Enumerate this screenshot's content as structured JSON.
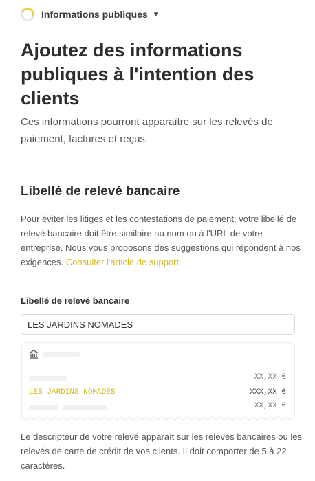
{
  "header": {
    "section_selector": "Informations publiques",
    "icons": {
      "progress": "progress-ring-icon",
      "dropdown": "chevron-down-icon"
    }
  },
  "page": {
    "title": "Ajoutez des informations publiques à l'intention des clients",
    "subtitle": "Ces informations pourront apparaître sur les relevés de paiement, factures et reçus."
  },
  "statement_section": {
    "heading": "Libellé de relevé bancaire",
    "description": "Pour éviter les litiges et les contestations de paiement, votre libellé de relevé bancaire doit être similaire au nom ou à l'URL de votre entreprise. Nous vous proposons des suggestions qui répondent à nos exigences.",
    "support_link": "Consulter l'article de support",
    "field_label": "Libellé de relevé bancaire",
    "field_value": "LES JARDINS NOMADES",
    "preview": {
      "bank_icon": "bank-icon",
      "rows": [
        {
          "label": "",
          "amount": "XX,XX €",
          "highlight": false
        },
        {
          "label": "LES JARDINS NOMADES",
          "amount": "XXX,XX €",
          "highlight": true
        },
        {
          "label": "",
          "amount": "XX,XX €",
          "highlight": false
        }
      ]
    },
    "footer_note": "Le descripteur de votre relevé apparaît sur les relevés bancaires ou les relevés de carte de crédit de vos clients. Il doit comporter de 5 à 22 caractères."
  },
  "colors": {
    "accent": "#d4b722",
    "ring": "#ead24a",
    "text": "#2d2d2d",
    "muted": "#555555"
  }
}
